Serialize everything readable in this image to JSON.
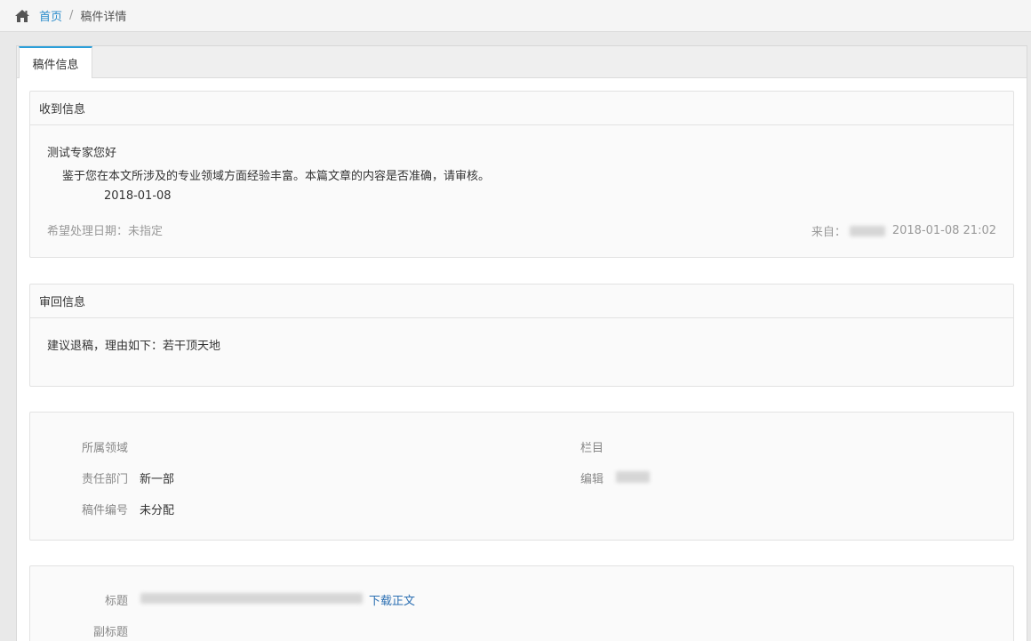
{
  "breadcrumb": {
    "icon": "home-icon",
    "home_label": "首页",
    "separator": "/",
    "current_label": "稿件详情"
  },
  "tabs": [
    {
      "label": "稿件信息",
      "active": true
    }
  ],
  "received": {
    "heading": "收到信息",
    "greeting": "测试专家您好",
    "message": "鉴于您在本文所涉及的专业领域方面经验丰富。本篇文章的内容是否准确，请审核。",
    "message_date": "2018-01-08",
    "expected_date": "希望处理日期：未指定",
    "from_label": "来自：",
    "from_datetime": "2018-01-08 21:02"
  },
  "review": {
    "heading": "审回信息",
    "text": "建议退稿，理由如下：若干顶天地"
  },
  "details": {
    "field_label": "所属领域",
    "column_label": "栏目",
    "department_label": "责任部门",
    "department_value": "新一部",
    "editor_label": "编辑",
    "number_label": "稿件编号",
    "number_value": "未分配"
  },
  "article": {
    "title_label": "标题",
    "download_link": "下载正文",
    "subtitle_label": "副标题"
  },
  "colors": {
    "accent": "#2b9fd9",
    "link": "#2b8ccb"
  }
}
